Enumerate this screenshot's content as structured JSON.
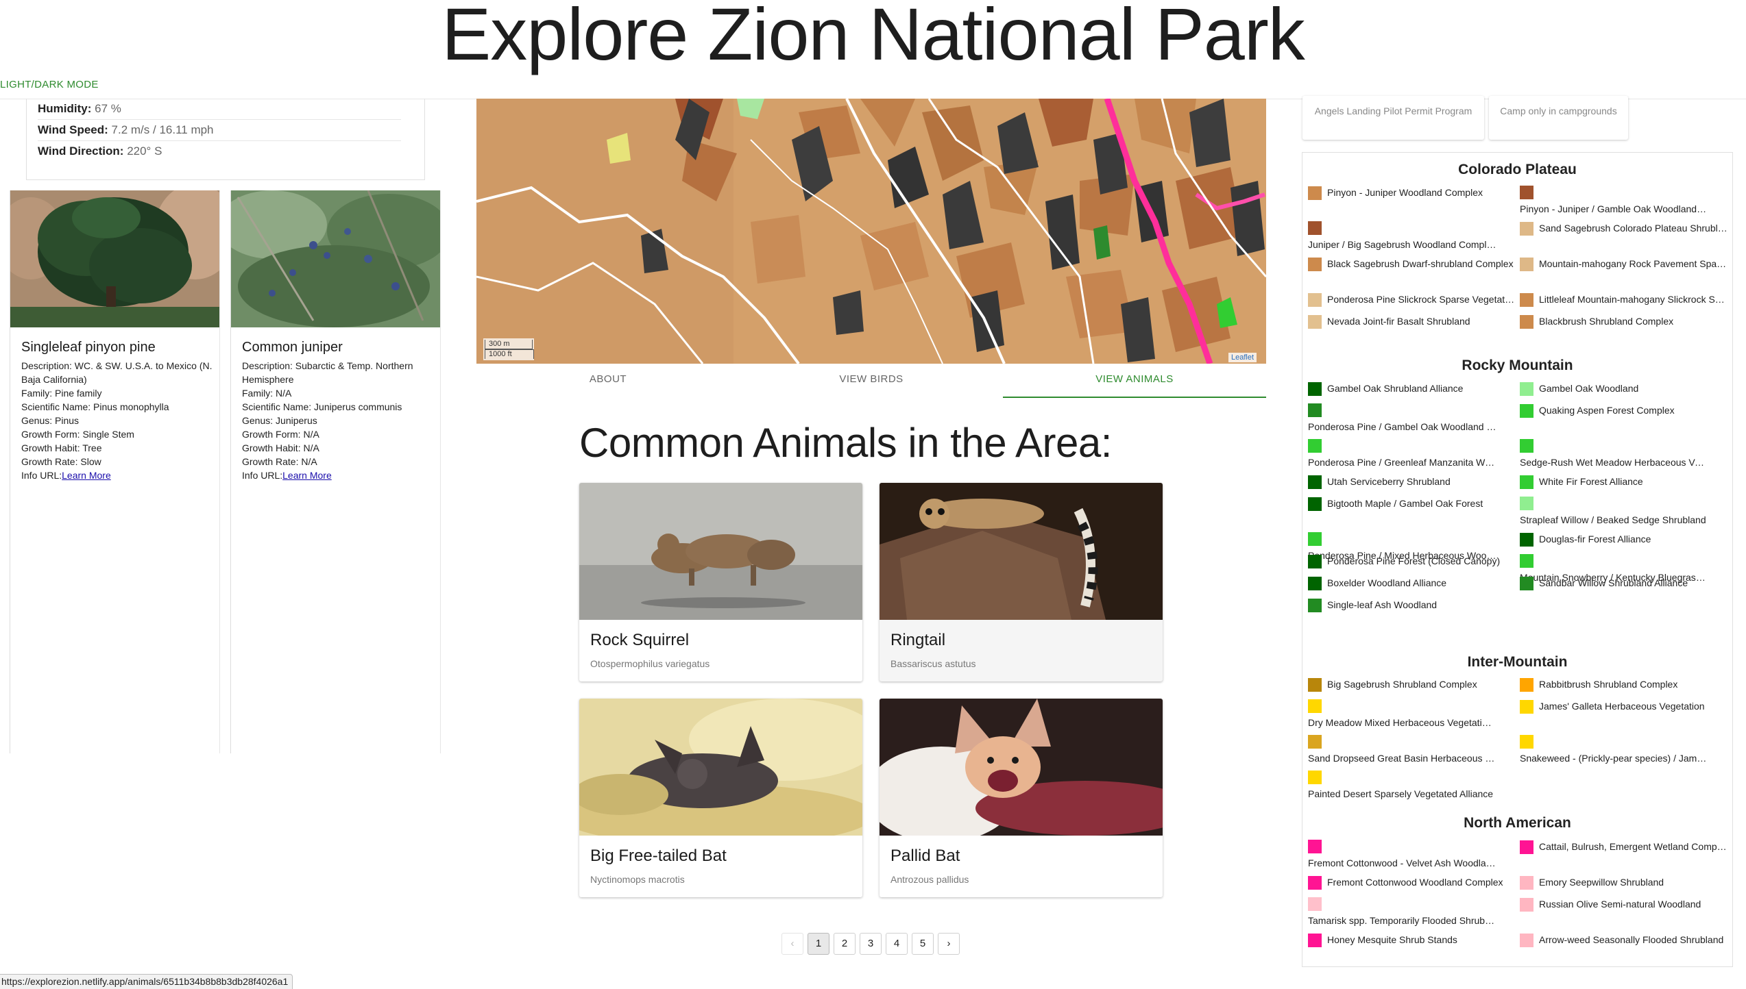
{
  "header": {
    "title": "Explore Zion National Park",
    "theme_toggle": "LIGHT/DARK MODE"
  },
  "weather": {
    "rows": [
      {
        "label": "Humidity:",
        "value": "67 %"
      },
      {
        "label": "Wind Speed:",
        "value": "7.2 m/s / 16.11 mph"
      },
      {
        "label": "Wind Direction:",
        "value": "220° S"
      }
    ]
  },
  "plants": [
    {
      "name": "Singleleaf pinyon pine",
      "description": "Description: WC. & SW. U.S.A. to Mexico (N. Baja California)",
      "family": "Family: Pine family",
      "scientific": "Scientific Name: Pinus monophylla",
      "genus": "Genus: Pinus",
      "growth_form": "Growth Form: Single Stem",
      "growth_habit": "Growth Habit: Tree",
      "growth_rate": "Growth Rate: Slow",
      "info_label": "Info URL:",
      "link_text": "Learn More"
    },
    {
      "name": "Common juniper",
      "description": "Description: Subarctic & Temp. Northern Hemisphere",
      "family": "Family: N/A",
      "scientific": "Scientific Name: Juniperus communis",
      "genus": "Genus: Juniperus",
      "growth_form": "Growth Form: N/A",
      "growth_habit": "Growth Habit: N/A",
      "growth_rate": "Growth Rate: N/A",
      "info_label": "Info URL:",
      "link_text": "Learn More"
    }
  ],
  "map": {
    "scale_metric": "300 m",
    "scale_imperial": "1000 ft",
    "attribution": "Leaflet"
  },
  "tabs": [
    {
      "label": "ABOUT",
      "active": false
    },
    {
      "label": "VIEW BIRDS",
      "active": false
    },
    {
      "label": "VIEW ANIMALS",
      "active": true
    }
  ],
  "animals_section": {
    "heading": "Common Animals in the Area:",
    "animals": [
      {
        "name": "Rock Squirrel",
        "scientific": "Otospermophilus variegatus"
      },
      {
        "name": "Ringtail",
        "scientific": "Bassariscus astutus"
      },
      {
        "name": "Big Free-tailed Bat",
        "scientific": "Nyctinomops macrotis"
      },
      {
        "name": "Pallid Bat",
        "scientific": "Antrozous pallidus"
      }
    ]
  },
  "pagination": {
    "prev": "‹",
    "pages": [
      "1",
      "2",
      "3",
      "4",
      "5"
    ],
    "current": "1",
    "next": "›"
  },
  "notices": [
    "Angels Landing Pilot Permit Program",
    "Camp only in campgrounds"
  ],
  "legend": {
    "colorado_plateau": {
      "title": "Colorado Plateau",
      "items": [
        {
          "label": "Pinyon - Juniper Woodland Complex",
          "color": "#cd8a4c"
        },
        {
          "label": "Pinyon - Juniper / Gamble Oak Woodland Co...",
          "color": "#a0522d"
        },
        {
          "label": "Juniper / Big Sagebrush Woodland Complex",
          "color": "#a0522d"
        },
        {
          "label": "Sand Sagebrush Colorado Plateau Shrubland",
          "color": "#deb887"
        },
        {
          "label": "Black Sagebrush Dwarf-shrubland Complex",
          "color": "#cd8a4c"
        },
        {
          "label": "Mountain-mahogany Rock Pavement Sparse ...",
          "color": "#deb887"
        },
        {
          "label": "Ponderosa Pine Slickrock Sparse Vegetation",
          "color": "#e2c08f"
        },
        {
          "label": "Littleleaf Mountain-mahogany Slickrock Spars...",
          "color": "#cd8a4c"
        },
        {
          "label": "Nevada Joint-fir Basalt Shrubland",
          "color": "#e2c08f"
        },
        {
          "label": "Blackbrush Shrubland Complex",
          "color": "#cd8a4c"
        }
      ]
    },
    "rocky_mountain": {
      "title": "Rocky Mountain",
      "items": [
        {
          "label": "Gambel Oak Shrubland Alliance",
          "color": "#006400"
        },
        {
          "label": "Gambel Oak Woodland",
          "color": "#90ee90"
        },
        {
          "label": "Ponderosa Pine / Gambel Oak Woodland Com...",
          "color": "#228b22"
        },
        {
          "label": "Quaking Aspen Forest Complex",
          "color": "#32cd32"
        },
        {
          "label": "Ponderosa Pine / Greenleaf Manzanita Woodl...",
          "color": "#32cd32"
        },
        {
          "label": "Sedge-Rush Wet Meadow Herbaceous Vegeta...",
          "color": "#32cd32"
        },
        {
          "label": "Utah Serviceberry Shrubland",
          "color": "#006400"
        },
        {
          "label": "White Fir Forest Alliance",
          "color": "#32cd32"
        },
        {
          "label": "Bigtooth Maple / Gambel Oak Forest",
          "color": "#006400"
        },
        {
          "label": "Strapleaf Willow / Beaked Sedge Shrubland",
          "color": "#90ee90"
        },
        {
          "label": "Ponderosa Pine / Mixed Herbaceous Woodlan...",
          "color": "#32cd32"
        },
        {
          "label": "Douglas-fir Forest Alliance",
          "color": "#006400"
        },
        {
          "label": "Ponderosa Pine Forest (Closed Canopy)",
          "color": "#006400"
        },
        {
          "label": "Mountain Snowberry / Kentucky Bluegrass Se...",
          "color": "#32cd32"
        },
        {
          "label": "Boxelder Woodland Alliance",
          "color": "#006400"
        },
        {
          "label": "Sandbar Willow Shrubland Alliance",
          "color": "#228b22"
        },
        {
          "label": "Single-leaf Ash Woodland",
          "color": "#228b22"
        }
      ]
    },
    "inter_mountain": {
      "title": "Inter-Mountain",
      "items": [
        {
          "label": "Big Sagebrush Shrubland Complex",
          "color": "#b8860b"
        },
        {
          "label": "Rabbitbrush Shrubland Complex",
          "color": "#ffa500"
        },
        {
          "label": "Dry Meadow Mixed Herbaceous Vegetation M...",
          "color": "#ffd700"
        },
        {
          "label": "James' Galleta Herbaceous Vegetation",
          "color": "#ffd700"
        },
        {
          "label": "Sand Dropseed Great Basin Herbaceous Vege...",
          "color": "#daa520"
        },
        {
          "label": "Snakeweed - (Prickly-pear species) / James' ...",
          "color": "#ffd700"
        },
        {
          "label": "Painted Desert Sparsely Vegetated Alliance",
          "color": "#ffd700"
        }
      ]
    },
    "north_american": {
      "title": "North American",
      "items": [
        {
          "label": "Fremont Cottonwood - Velvet Ash Woodland",
          "color": "#ff1493"
        },
        {
          "label": "Cattail, Bulrush, Emergent Wetland Complex",
          "color": "#ff1493"
        },
        {
          "label": "Fremont Cottonwood Woodland Complex",
          "color": "#ff1493"
        },
        {
          "label": "Emory Seepwillow Shrubland",
          "color": "#ffb6c1"
        },
        {
          "label": "Tamarisk spp. Temporarily Flooded Shrubland",
          "color": "#ffc0cb"
        },
        {
          "label": "Russian Olive Semi-natural Woodland",
          "color": "#ffb6c1"
        },
        {
          "label": "Honey Mesquite Shrub Stands",
          "color": "#ff1493"
        },
        {
          "label": "Arrow-weed Seasonally Flooded Shrubland",
          "color": "#ffb6c1"
        }
      ]
    }
  },
  "status_bar": {
    "url": "https://explorezion.netlify.app/animals/6511b34b8b8b3db28f4026a1"
  }
}
